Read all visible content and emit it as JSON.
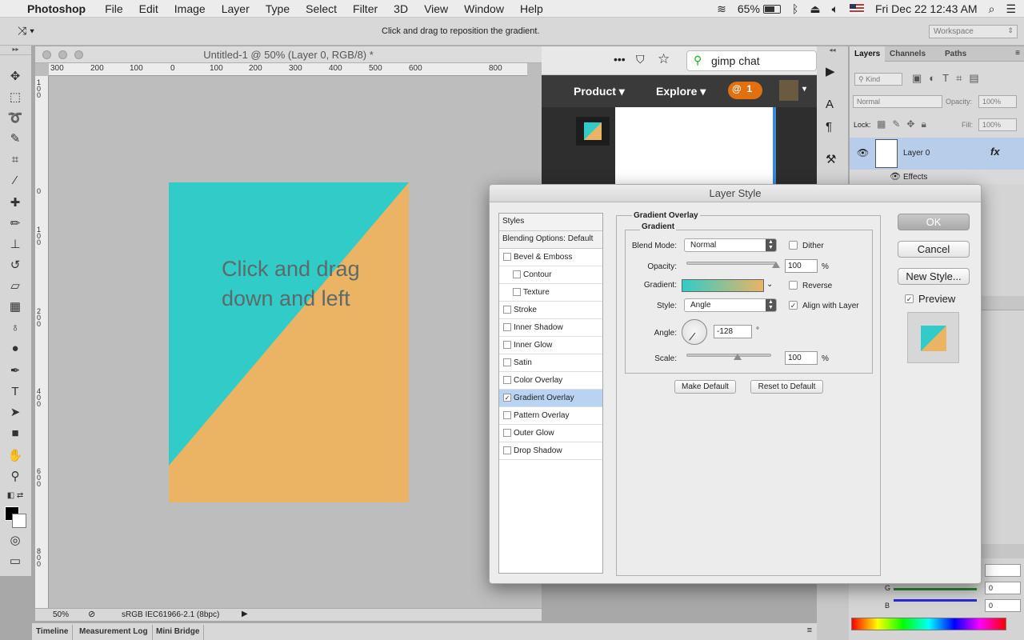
{
  "menubar": {
    "app_name": "Photoshop",
    "items": [
      "File",
      "Edit",
      "Image",
      "Layer",
      "Type",
      "Select",
      "Filter",
      "3D",
      "View",
      "Window",
      "Help"
    ],
    "battery": "65%",
    "datetime": "Fri Dec 22  12:43 AM"
  },
  "options_bar": {
    "hint": "Click and drag to reposition the gradient.",
    "workspace": "Workspace"
  },
  "document": {
    "title": "Untitled-1 @ 50% (Layer 0, RGB/8) *",
    "ruler_labels": [
      "300",
      "200",
      "100",
      "0",
      "100",
      "200",
      "300",
      "400",
      "500",
      "600",
      "800"
    ],
    "zoom": "50%",
    "profile": "sRGB IEC61966-2.1 (8bpc)",
    "canvas_text": "Click and drag down and left",
    "colors": {
      "teal": "#31ccc7",
      "orange": "#eab464"
    }
  },
  "browser": {
    "search_text": "gimp chat",
    "nav_product": "Product",
    "nav_explore": "Explore",
    "notif_count": "1"
  },
  "dialog": {
    "title": "Layer Style",
    "styles_header": "Styles",
    "blending": "Blending Options: Default",
    "items": [
      {
        "label": "Bevel & Emboss",
        "checked": false,
        "sub": false
      },
      {
        "label": "Contour",
        "checked": false,
        "sub": true
      },
      {
        "label": "Texture",
        "checked": false,
        "sub": true
      },
      {
        "label": "Stroke",
        "checked": false,
        "sub": false
      },
      {
        "label": "Inner Shadow",
        "checked": false,
        "sub": false
      },
      {
        "label": "Inner Glow",
        "checked": false,
        "sub": false
      },
      {
        "label": "Satin",
        "checked": false,
        "sub": false
      },
      {
        "label": "Color Overlay",
        "checked": false,
        "sub": false
      },
      {
        "label": "Gradient Overlay",
        "checked": true,
        "sub": false
      },
      {
        "label": "Pattern Overlay",
        "checked": false,
        "sub": false
      },
      {
        "label": "Outer Glow",
        "checked": false,
        "sub": false
      },
      {
        "label": "Drop Shadow",
        "checked": false,
        "sub": false
      }
    ],
    "section_title": "Gradient Overlay",
    "group_title": "Gradient",
    "blend_mode_label": "Blend Mode:",
    "blend_mode": "Normal",
    "dither": "Dither",
    "opacity_label": "Opacity:",
    "opacity": "100",
    "opacity_level": 1.0,
    "gradient_label": "Gradient:",
    "reverse": "Reverse",
    "style_label": "Style:",
    "style": "Angle",
    "align_with_layer": "Align with Layer",
    "angle_label": "Angle:",
    "angle": "-128",
    "degree": "°",
    "scale_label": "Scale:",
    "scale": "100",
    "scale_level": 0.6,
    "percent": "%",
    "make_default": "Make Default",
    "reset_default": "Reset to Default",
    "ok": "OK",
    "cancel": "Cancel",
    "new_style": "New Style...",
    "preview": "Preview"
  },
  "layers_panel": {
    "tabs": [
      "Layers",
      "Channels",
      "Paths"
    ],
    "kind": "Kind",
    "blend": "Normal",
    "opacity_label": "Opacity:",
    "opacity": "100%",
    "lock_label": "Lock:",
    "fill_label": "Fill:",
    "fill": "100%",
    "layer_name": "Layer 0",
    "fx": "fx",
    "effects": "Effects",
    "g_label": "G",
    "b_label": "B",
    "g_value": "0",
    "b_value": "0"
  },
  "bottom_tabs": [
    "Timeline",
    "Measurement Log",
    "Mini Bridge"
  ]
}
